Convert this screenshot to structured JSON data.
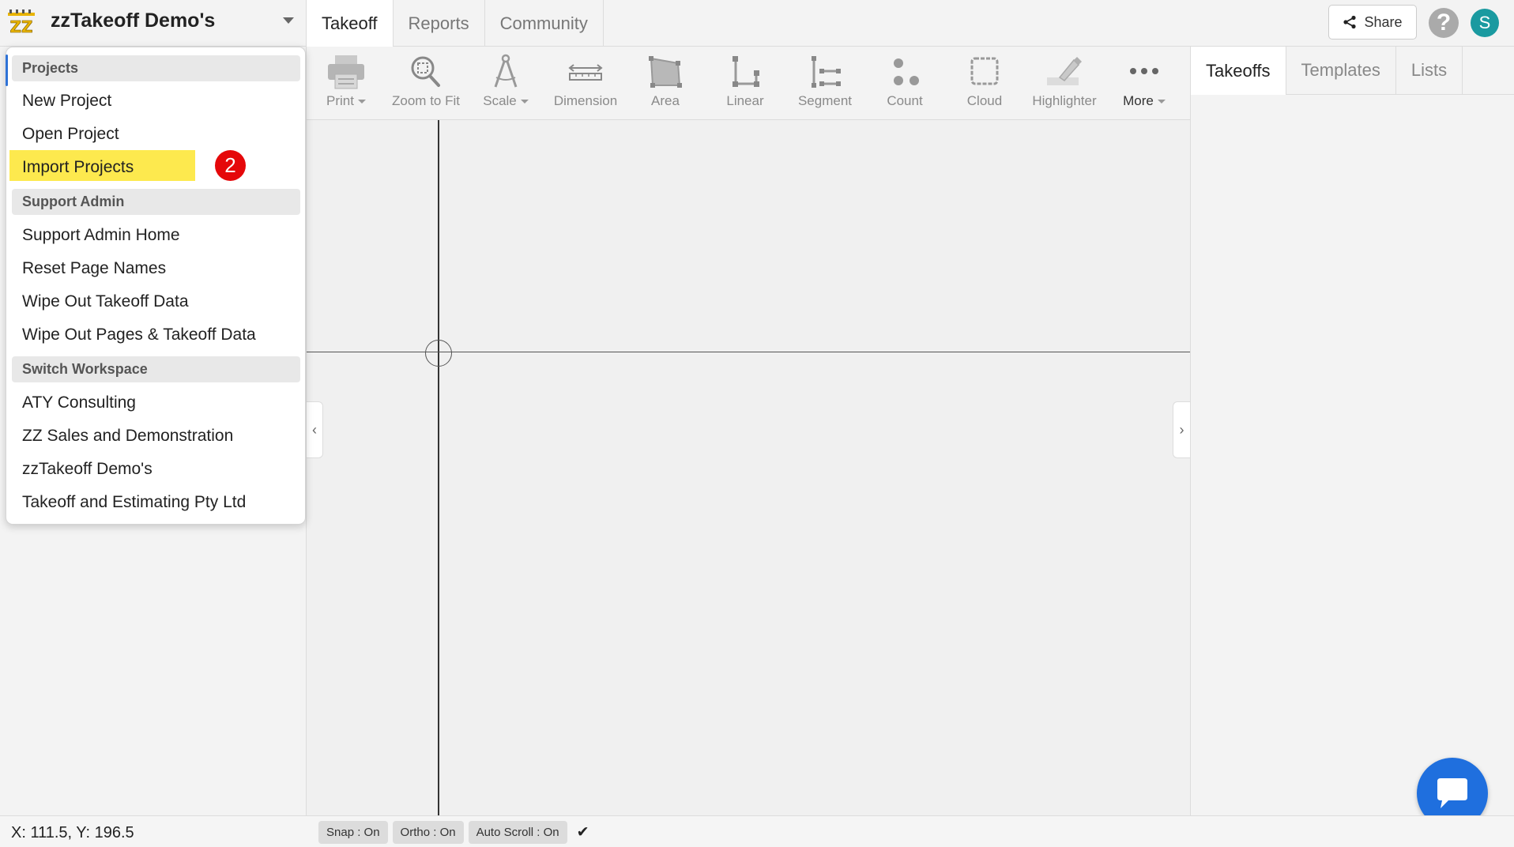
{
  "header": {
    "workspace_title": "zzTakeoff Demo's",
    "nav_tabs": [
      {
        "label": "Takeoff",
        "active": true
      },
      {
        "label": "Reports",
        "active": false
      },
      {
        "label": "Community",
        "active": false
      }
    ],
    "share_label": "Share",
    "help_glyph": "?",
    "avatar_initial": "S"
  },
  "toolbar": {
    "tools": [
      {
        "label": "Print",
        "icon": "printer-icon"
      },
      {
        "label": "Zoom to Fit",
        "icon": "zoom-fit-icon"
      },
      {
        "label": "Scale",
        "icon": "compass-icon"
      },
      {
        "label": "Dimension",
        "icon": "dimension-icon"
      },
      {
        "label": "Area",
        "icon": "area-icon"
      },
      {
        "label": "Linear",
        "icon": "linear-icon"
      },
      {
        "label": "Segment",
        "icon": "segment-icon"
      },
      {
        "label": "Count",
        "icon": "count-icon"
      },
      {
        "label": "Cloud",
        "icon": "cloud-icon"
      },
      {
        "label": "Highlighter",
        "icon": "highlighter-icon"
      },
      {
        "label": "More",
        "icon": "more-icon"
      }
    ]
  },
  "right_panel": {
    "tabs": [
      {
        "label": "Takeoffs",
        "active": true
      },
      {
        "label": "Templates",
        "active": false
      },
      {
        "label": "Lists",
        "active": false
      }
    ]
  },
  "dropdown": {
    "sections": [
      {
        "header": "Projects",
        "items": [
          "New Project",
          "Open Project",
          "Import Projects"
        ]
      },
      {
        "header": "Support Admin",
        "items": [
          "Support Admin Home",
          "Reset Page Names",
          "Wipe Out Takeoff Data",
          "Wipe Out Pages & Takeoff Data"
        ]
      },
      {
        "header": "Switch Workspace",
        "items": [
          "ATY Consulting",
          "ZZ Sales and Demonstration",
          "zzTakeoff Demo's",
          "Takeoff and Estimating Pty Ltd"
        ]
      }
    ],
    "highlighted_item": "Import Projects",
    "step_badge": "2"
  },
  "statusbar": {
    "coords": "X: 111.5, Y: 196.5",
    "pills": [
      "Snap : On",
      "Ortho : On",
      "Auto Scroll : On"
    ],
    "check_glyph": "✔"
  },
  "colors": {
    "accent_blue": "#1f6fde",
    "highlight_yellow": "#fde94e",
    "badge_red": "#e5080a",
    "avatar_teal": "#1a9aa0"
  }
}
